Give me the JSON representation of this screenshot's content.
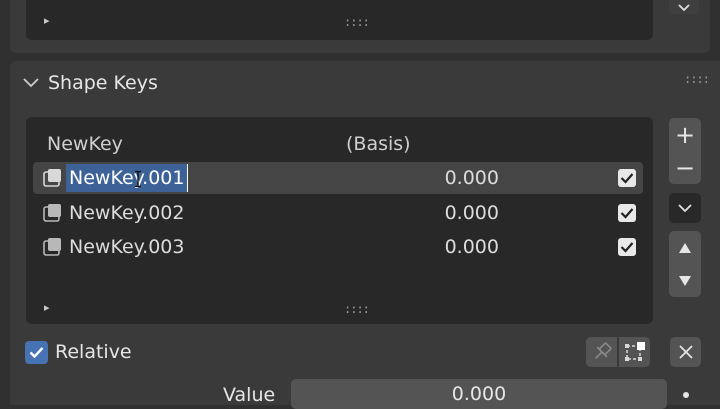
{
  "top_panel": {
    "expand_glyph": "▸",
    "grip_glyph": "::::",
    "chevron_glyph": "⌄"
  },
  "shape_keys": {
    "title": "Shape Keys",
    "header_grip": "::::",
    "reference_key": "NewKey",
    "reference_label": "(Basis)",
    "rows": [
      {
        "name": "NewKey.001",
        "value": "0.000",
        "checked": true,
        "active": true,
        "editing": true
      },
      {
        "name": "NewKey.002",
        "value": "0.000",
        "checked": true,
        "active": false,
        "editing": false
      },
      {
        "name": "NewKey.003",
        "value": "0.000",
        "checked": true,
        "active": false,
        "editing": false
      }
    ],
    "list_expand_glyph": "▸",
    "list_grip": "::::",
    "side_buttons": {
      "add": "+",
      "remove": "−",
      "specials_icon": "chevron-down-icon",
      "move_up_icon": "triangle-up-icon",
      "move_down_icon": "triangle-down-icon"
    },
    "relative_label": "Relative",
    "relative_checked": true,
    "pin_icon": "pin-icon",
    "edit_mode_icon": "edit-mode-icon",
    "clear_icon": "close-icon",
    "value_label": "Value",
    "value_field": "0.000"
  },
  "colors": {
    "accent": "#4772b3",
    "selection": "#3d6297",
    "panel": "#3a3a3a",
    "list_bg": "#282828"
  }
}
